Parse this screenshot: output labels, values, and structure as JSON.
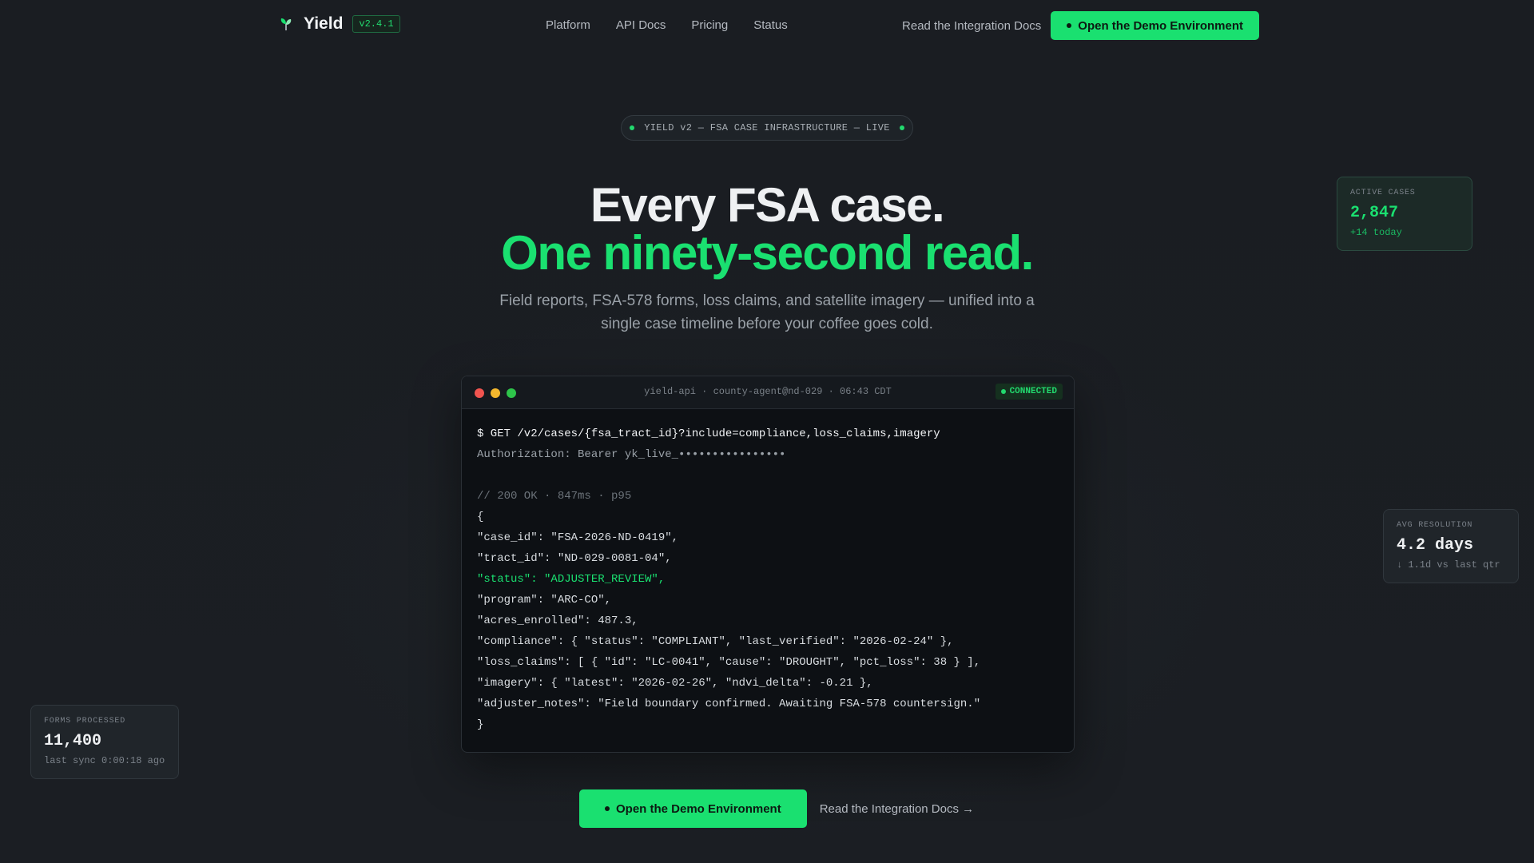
{
  "nav": {
    "brand": "Yield",
    "version": "v2.4.1",
    "links": [
      "Platform",
      "API Docs",
      "Pricing",
      "Status"
    ],
    "docs_link": "Read the Integration Docs",
    "cta": "Open the Demo Environment"
  },
  "hero": {
    "pill": "YIELD v2 — FSA CASE INFRASTRUCTURE — LIVE",
    "headline_1": "Every FSA case.",
    "headline_2": "One ninety-second read.",
    "subtitle": "Field reports, FSA-578 forms, loss claims, and satellite imagery — unified into a single case timeline before your coffee goes cold."
  },
  "terminal": {
    "title": "yield-api · county-agent@nd-029 · 06:43 CDT",
    "status": "CONNECTED",
    "lines": [
      {
        "text": "$ GET /v2/cases/{fsa_tract_id}?include=compliance,loss_claims,imagery",
        "style": "cmd"
      },
      {
        "text": "Authorization: Bearer yk_live_••••••••••••••••",
        "style": "dim"
      },
      {
        "text": "",
        "style": "plain"
      },
      {
        "text": "// 200 OK · 847ms · p95",
        "style": "comment"
      },
      {
        "text": "{",
        "style": "plain"
      },
      {
        "text": "\"case_id\": \"FSA-2026-ND-0419\",",
        "style": "plain"
      },
      {
        "text": "\"tract_id\": \"ND-029-0081-04\",",
        "style": "plain"
      },
      {
        "text": "\"status\": \"ADJUSTER_REVIEW\",",
        "style": "hl"
      },
      {
        "text": "\"program\": \"ARC-CO\",",
        "style": "plain"
      },
      {
        "text": "\"acres_enrolled\": 487.3,",
        "style": "plain"
      },
      {
        "text": "\"compliance\": { \"status\": \"COMPLIANT\", \"last_verified\": \"2026-02-24\" },",
        "style": "plain"
      },
      {
        "text": "\"loss_claims\": [ { \"id\": \"LC-0041\", \"cause\": \"DROUGHT\", \"pct_loss\": 38 } ],",
        "style": "plain"
      },
      {
        "text": "\"imagery\": { \"latest\": \"2026-02-26\", \"ndvi_delta\": -0.21 },",
        "style": "plain"
      },
      {
        "text": "\"adjuster_notes\": \"Field boundary confirmed. Awaiting FSA-578 countersign.\"",
        "style": "plain"
      },
      {
        "text": "}",
        "style": "plain"
      }
    ]
  },
  "cta": {
    "primary": "Open the Demo Environment",
    "secondary": "Read the Integration Docs →"
  },
  "stats": {
    "active": {
      "label": "ACTIVE CASES",
      "value": "2,847",
      "note": "+14 today"
    },
    "resolution": {
      "label": "AVG RESOLUTION",
      "value": "4.2 days",
      "note": "↓ 1.1d vs last qtr"
    },
    "forms": {
      "label": "FORMS PROCESSED",
      "value": "11,400",
      "note": "last sync 0:00:18 ago"
    }
  },
  "colors": {
    "accent": "#1ae070",
    "background": "#1a1d22"
  }
}
